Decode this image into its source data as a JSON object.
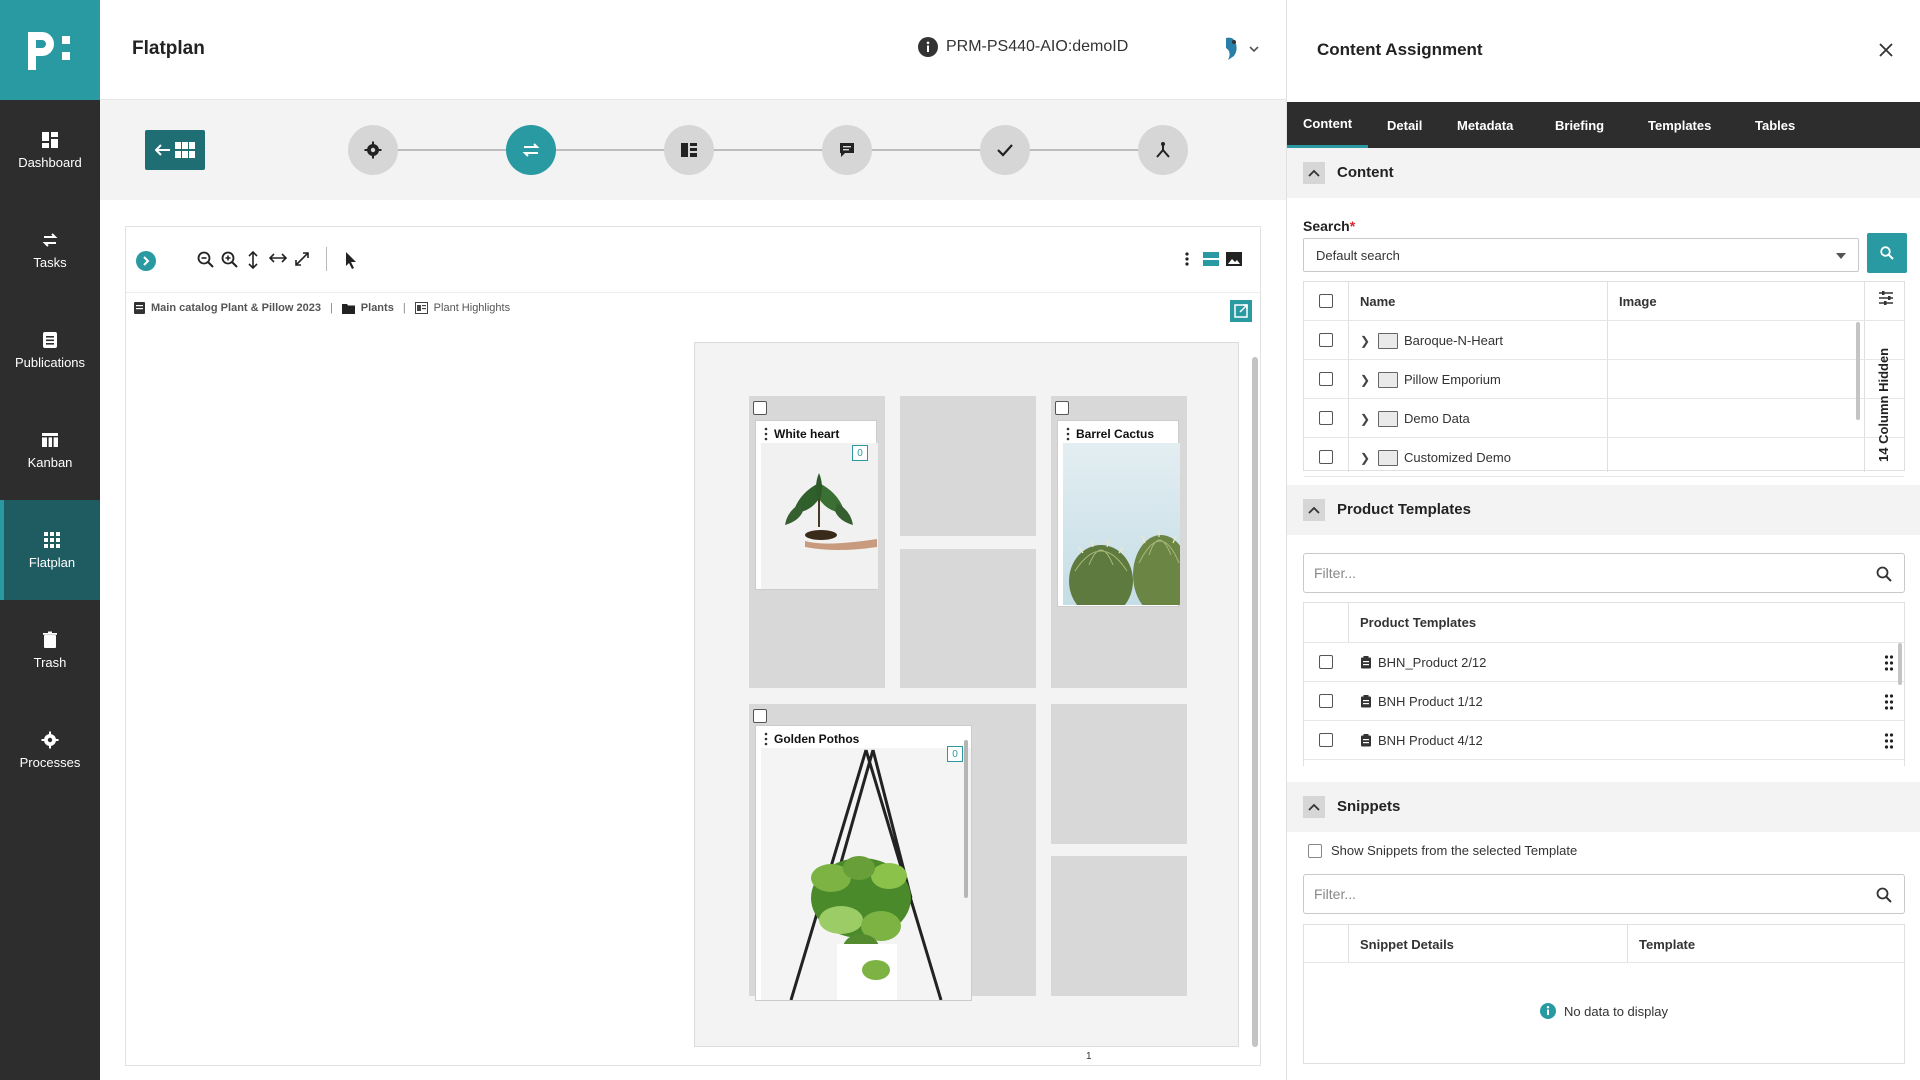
{
  "sidebar": {
    "items": [
      {
        "label": "Dashboard",
        "icon": "dashboard-icon"
      },
      {
        "label": "Tasks",
        "icon": "tasks-icon"
      },
      {
        "label": "Publications",
        "icon": "publications-icon"
      },
      {
        "label": "Kanban",
        "icon": "kanban-icon"
      },
      {
        "label": "Flatplan",
        "icon": "flatplan-icon",
        "active": true
      },
      {
        "label": "Trash",
        "icon": "trash-icon"
      },
      {
        "label": "Processes",
        "icon": "gear-icon"
      }
    ]
  },
  "header": {
    "title": "Flatplan",
    "doc_id": "PRM-PS440-AIO:demoID"
  },
  "breadcrumb": {
    "catalog": "Main catalog Plant & Pillow 2023",
    "folder": "Plants",
    "page": "Plant Highlights"
  },
  "flatplan": {
    "cards": [
      {
        "title": "White heart",
        "badge": "0"
      },
      {
        "title": "Barrel Cactus"
      },
      {
        "title": "Golden Pothos",
        "badge": "0"
      }
    ],
    "page_number": "1"
  },
  "panel": {
    "title": "Content Assignment",
    "tabs": [
      "Content",
      "Detail",
      "Metadata",
      "Briefing",
      "Templates",
      "Tables"
    ],
    "content_section": {
      "title": "Content",
      "search_label": "Search",
      "required_mark": "*",
      "search_value": "Default search",
      "columns": [
        "Name",
        "Image"
      ],
      "hidden_columns": "14 Column Hidden",
      "rows": [
        "Baroque-N-Heart",
        "Pillow Emporium",
        "Demo Data",
        "Customized Demo"
      ]
    },
    "templates_section": {
      "title": "Product Templates",
      "filter_placeholder": "Filter...",
      "column": "Product Templates",
      "rows": [
        "BHN_Product 2/12",
        "BNH Product 1/12",
        "BNH Product 4/12"
      ]
    },
    "snippets_section": {
      "title": "Snippets",
      "checkbox_label": "Show Snippets from the selected Template",
      "filter_placeholder": "Filter...",
      "columns": [
        "Snippet Details",
        "Template"
      ],
      "empty_text": "No data to display"
    }
  },
  "colors": {
    "accent": "#2a9aa2",
    "sidebar": "#2d2d2d",
    "sidebar_active": "#1f5c62"
  }
}
